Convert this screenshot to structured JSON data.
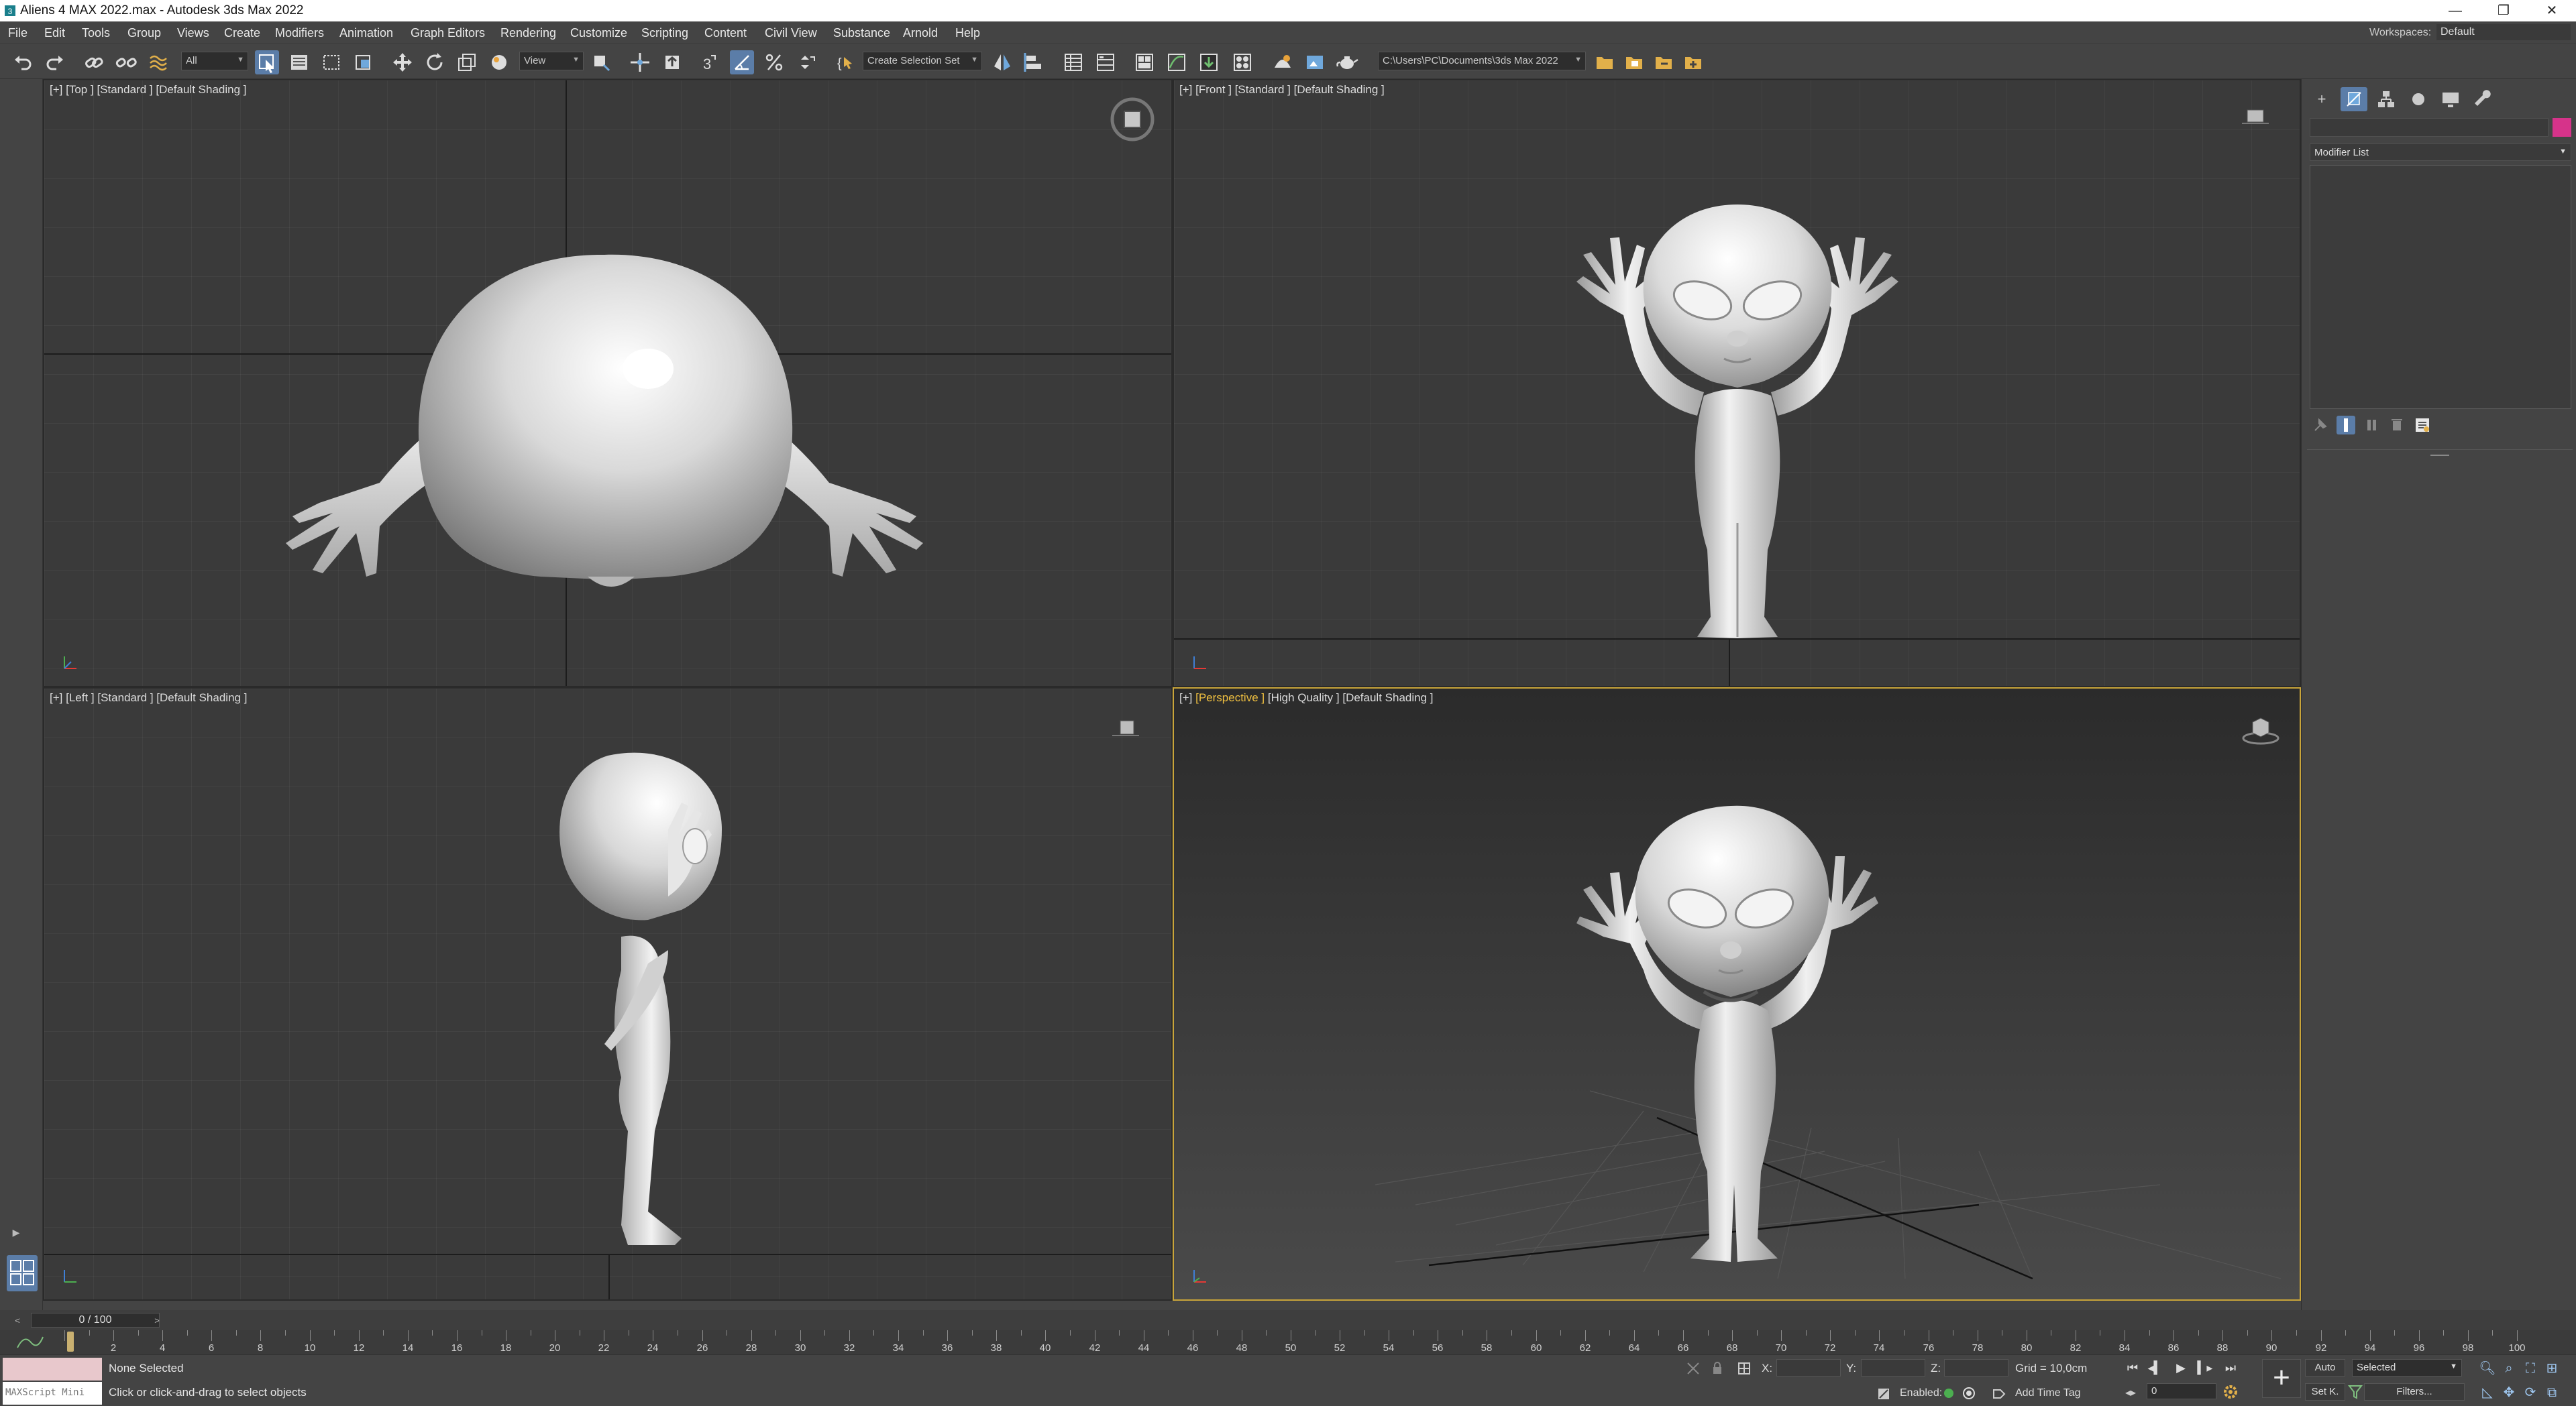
{
  "window": {
    "title": "Aliens 4 MAX 2022.max - Autodesk 3ds Max 2022",
    "minimize_glyph": "—",
    "restore_glyph": "❐",
    "close_glyph": "✕"
  },
  "menu": {
    "items": [
      "File",
      "Edit",
      "Tools",
      "Group",
      "Views",
      "Create",
      "Modifiers",
      "Animation",
      "Graph Editors",
      "Rendering",
      "Customize",
      "Scripting",
      "Content",
      "Civil View",
      "Substance",
      "Arnold",
      "Help"
    ],
    "workspaces_label": "Workspaces:",
    "workspaces_value": "Default"
  },
  "toolbar": {
    "selection_filter": "All",
    "reference_coord": "View",
    "named_selection": "Create Selection Set",
    "project_path": "C:\\Users\\PC\\Documents\\3ds Max 2022",
    "snap_label": "3"
  },
  "viewports": {
    "top": {
      "bracket": "[+]",
      "view": "[Top ]",
      "mode": "[Standard ]",
      "shading": "[Default Shading ]"
    },
    "front": {
      "bracket": "[+]",
      "view": "[Front ]",
      "mode": "[Standard ]",
      "shading": "[Default Shading ]"
    },
    "left": {
      "bracket": "[+]",
      "view": "[Left ]",
      "mode": "[Standard ]",
      "shading": "[Default Shading ]"
    },
    "perspective": {
      "bracket": "[+]",
      "view": "[Perspective ]",
      "mode": "[High Quality ]",
      "shading": "[Default Shading ]"
    }
  },
  "command_panel": {
    "tab_icons": [
      "create-icon",
      "modify-icon",
      "hierarchy-icon",
      "motion-icon",
      "display-icon",
      "utilities-icon"
    ],
    "modifier_list": "Modifier List",
    "object_color": "#d6338a"
  },
  "time": {
    "frame_display": "0 / 100",
    "ticks": [
      "0",
      "2",
      "4",
      "6",
      "8",
      "10",
      "12",
      "14",
      "16",
      "18",
      "20",
      "22",
      "24",
      "26",
      "28",
      "30",
      "32",
      "34",
      "36",
      "38",
      "40",
      "42",
      "44",
      "46",
      "48",
      "50",
      "52",
      "54",
      "56",
      "58",
      "60",
      "62",
      "64",
      "66",
      "68",
      "70",
      "72",
      "74",
      "76",
      "78",
      "80",
      "82",
      "84",
      "86",
      "88",
      "90",
      "92",
      "94",
      "96",
      "98",
      "100"
    ],
    "ruler_labels": [
      "2",
      "4",
      "6",
      "8",
      "10",
      "12",
      "14",
      "16",
      "18",
      "20",
      "22",
      "24",
      "26",
      "28",
      "30",
      "32",
      "34",
      "36",
      "38",
      "40",
      "42",
      "44",
      "46",
      "48",
      "50",
      "52",
      "54",
      "56",
      "58",
      "60",
      "62",
      "64",
      "66",
      "68",
      "70",
      "72",
      "74",
      "76",
      "78",
      "80",
      "82",
      "84",
      "86",
      "88",
      "90",
      "92",
      "94",
      "96",
      "98",
      "100"
    ]
  },
  "status": {
    "maxscript": "MAXScript Mini",
    "selection": "None Selected",
    "prompt": "Click or click-and-drag to select objects",
    "x_label": "X:",
    "y_label": "Y:",
    "z_label": "Z:",
    "grid": "Grid = 10,0cm",
    "enabled_label": "Enabled:",
    "add_time_tag": "Add Time Tag",
    "auto": "Auto",
    "set_key": "Set K.",
    "key_mode": "Selected",
    "filters": "Filters...",
    "current_frame": "0",
    "key_glyph": "+"
  },
  "colors": {
    "ui_bg": "#444444",
    "viewport_bg": "#3a3a3a",
    "active_viewport_border": "#c9a53a",
    "accent_button": "#5b7da8",
    "viewport_label_highlight": "#f0c040",
    "model_color": "#e2e2e2"
  }
}
